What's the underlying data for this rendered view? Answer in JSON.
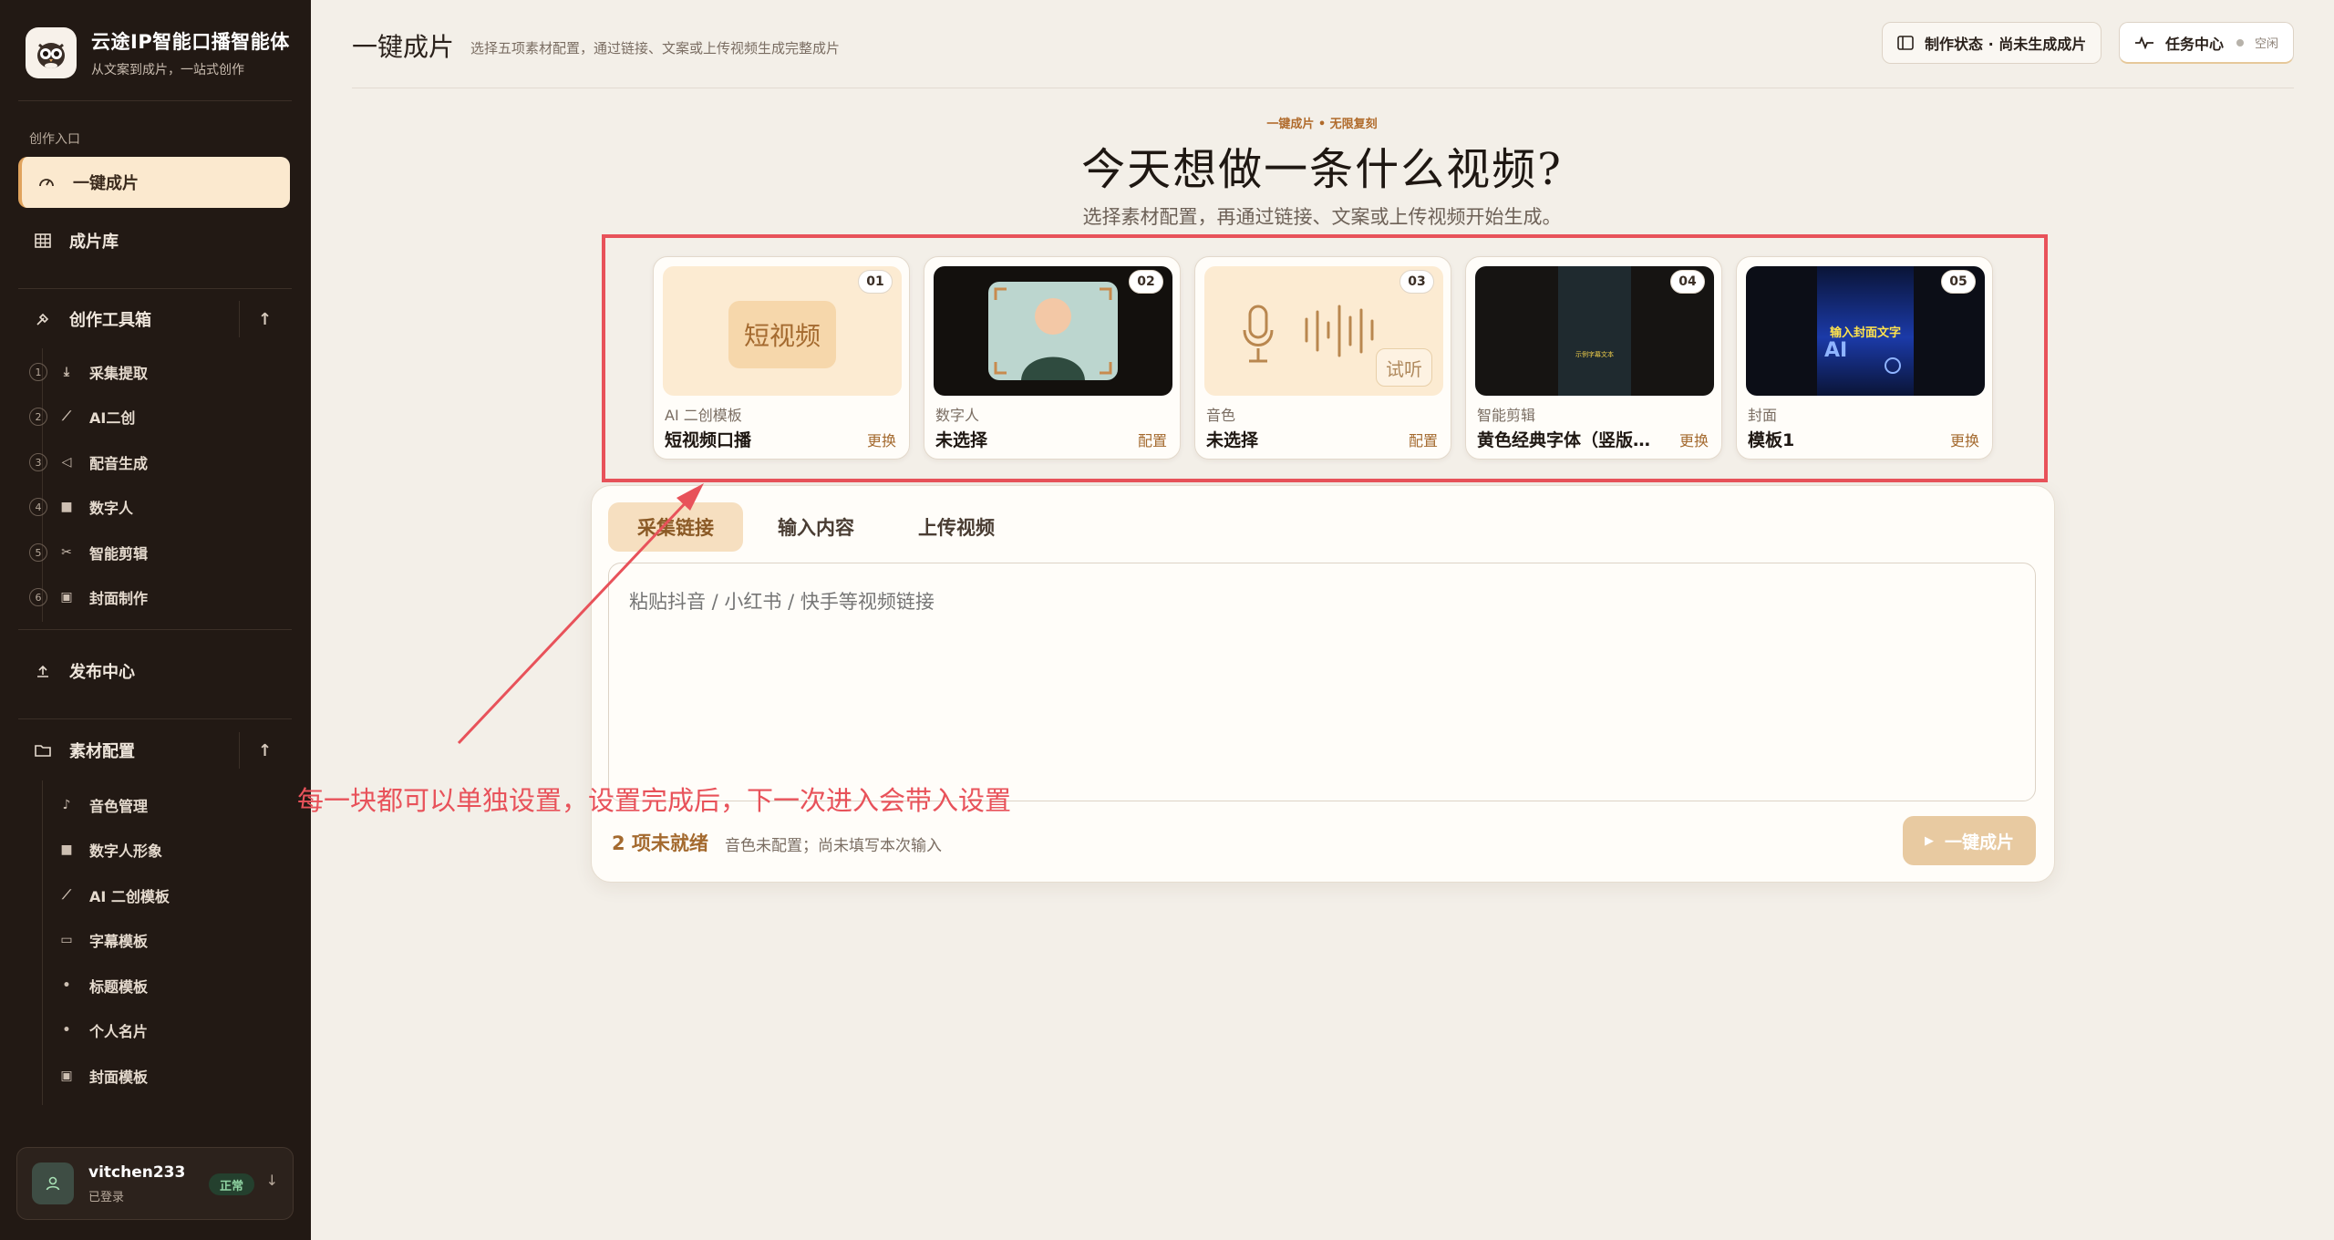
{
  "brand": {
    "title": "云途IP智能口播智能体",
    "subtitle": "从文案到成片，一站式创作"
  },
  "sidebar": {
    "section_label": "创作入口",
    "primary": [
      {
        "label": "一键成片",
        "icon": "gauge-icon",
        "active": true
      },
      {
        "label": "成片库",
        "icon": "grid-icon",
        "active": false
      }
    ],
    "toolbox": {
      "label": "创作工具箱",
      "items": [
        {
          "num": "1",
          "label": "采集提取",
          "icon": "download-icon"
        },
        {
          "num": "2",
          "label": "AI二创",
          "icon": "wand-icon"
        },
        {
          "num": "3",
          "label": "配音生成",
          "icon": "speaker-icon"
        },
        {
          "num": "4",
          "label": "数字人",
          "icon": "video-icon"
        },
        {
          "num": "5",
          "label": "智能剪辑",
          "icon": "scissors-icon"
        },
        {
          "num": "6",
          "label": "封面制作",
          "icon": "image-icon"
        }
      ]
    },
    "publish": {
      "label": "发布中心",
      "icon": "upload-icon"
    },
    "materials": {
      "label": "素材配置",
      "items": [
        {
          "label": "音色管理",
          "icon": "mic-icon"
        },
        {
          "label": "数字人形象",
          "icon": "video-icon"
        },
        {
          "label": "AI 二创模板",
          "icon": "wand-icon"
        },
        {
          "label": "字幕模板",
          "icon": "subtitle-icon"
        },
        {
          "label": "标题模板",
          "icon": "dot-icon"
        },
        {
          "label": "个人名片",
          "icon": "dot-icon"
        },
        {
          "label": "封面模板",
          "icon": "image-icon"
        }
      ]
    },
    "user": {
      "name": "vitchen233",
      "status": "已登录",
      "badge": "正常"
    }
  },
  "header": {
    "title": "一键成片",
    "description": "选择五项素材配置，通过链接、文案或上传视频生成完整成片",
    "status_pill": "制作状态 · 尚未生成成片",
    "task_pill": {
      "label": "任务中心",
      "state": "空闲"
    }
  },
  "hero": {
    "eyebrow": "一键成片 • 无限复刻",
    "title": "今天想做一条什么视频?",
    "subtitle": "选择素材配置，再通过链接、文案或上传视频开始生成。"
  },
  "cards": [
    {
      "num": "01",
      "category": "AI 二创模板",
      "value": "短视频口播",
      "action": "更换",
      "thumb_text": "短视频"
    },
    {
      "num": "02",
      "category": "数字人",
      "value": "未选择",
      "action": "配置"
    },
    {
      "num": "03",
      "category": "音色",
      "value": "未选择",
      "action": "配置",
      "thumb_text": "试听"
    },
    {
      "num": "04",
      "category": "智能剪辑",
      "value": "黄色经典字体（竖版…",
      "action": "更换",
      "thumb_text": "示例字幕文本"
    },
    {
      "num": "05",
      "category": "封面",
      "value": "模板1",
      "action": "更换",
      "thumb_text": "输入封面文字"
    }
  ],
  "input_panel": {
    "tabs": [
      {
        "label": "采集链接",
        "active": true
      },
      {
        "label": "输入内容",
        "active": false
      },
      {
        "label": "上传视频",
        "active": false
      }
    ],
    "placeholder": "粘贴抖音 / 小红书 / 快手等视频链接",
    "ready_count": "2 项未就绪",
    "ready_note": "音色未配置；尚未填写本次输入",
    "submit_label": "一键成片"
  },
  "annotation": {
    "text": "每一块都可以单独设置，设置完成后，下一次进入会带入设置",
    "color": "#e8525a"
  },
  "colors": {
    "sidebar_bg": "#221914",
    "accent": "#a46a2f",
    "active_nav": "#fbe9cf",
    "page_bg": "#f3efe8"
  }
}
